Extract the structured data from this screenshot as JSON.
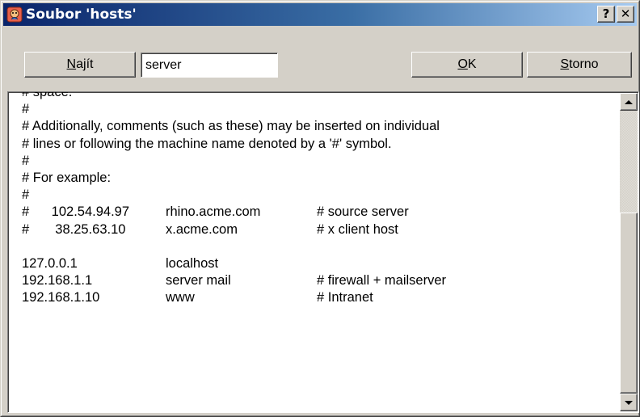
{
  "window": {
    "title": "Soubor 'hosts'",
    "help_glyph": "?",
    "close_glyph": "✕",
    "app_icon": "hosts-file-icon"
  },
  "toolbar": {
    "find_label_underlined": "N",
    "find_label_rest": "ajít",
    "search_value": "server",
    "ok_label_underlined": "O",
    "ok_label_rest": "K",
    "cancel_label_underlined": "S",
    "cancel_label_rest": "torno"
  },
  "editor": {
    "lines": [
      [
        "# space.",
        "",
        ""
      ],
      [
        "#",
        "",
        ""
      ],
      [
        "# Additionally, comments (such as these) may be inserted on individual",
        "",
        ""
      ],
      [
        "# lines or following the machine name denoted by a '#' symbol.",
        "",
        ""
      ],
      [
        "#",
        "",
        ""
      ],
      [
        "# For example:",
        "",
        ""
      ],
      [
        "#",
        "",
        ""
      ],
      [
        "#      102.54.94.97",
        "rhino.acme.com",
        "# source server"
      ],
      [
        "#       38.25.63.10",
        "x.acme.com",
        "# x client host"
      ],
      [
        "",
        "",
        ""
      ],
      [
        "127.0.0.1",
        "localhost",
        ""
      ],
      [
        "192.168.1.1",
        "server mail",
        "# firewall + mailserver"
      ],
      [
        "192.168.1.10",
        "www",
        "# Intranet"
      ]
    ]
  },
  "colors": {
    "titlebar_start": "#0a246a",
    "titlebar_end": "#a6caf0",
    "face": "#d4d0c8"
  }
}
